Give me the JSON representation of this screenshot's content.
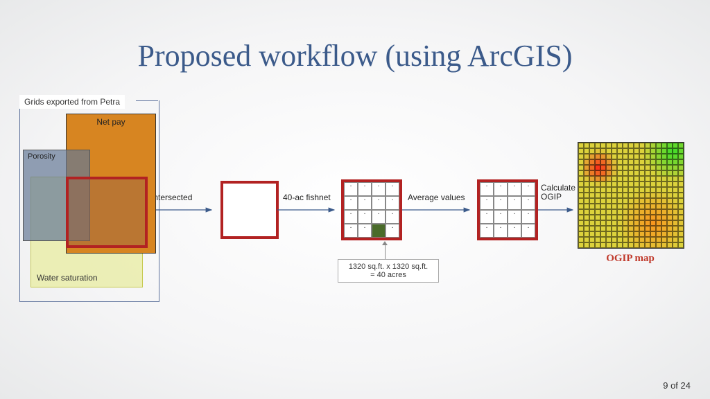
{
  "title": "Proposed workflow (using ArcGIS)",
  "footer": "9 of 24",
  "petra": {
    "group_label": "Grids exported from Petra",
    "netpay": "Net pay",
    "porosity": "Porosity",
    "watersat": "Water saturation"
  },
  "arrows": {
    "a1": "Intersected",
    "a2": "40-ac fishnet",
    "a3": "Average values",
    "a4": "Calculate OGIP"
  },
  "callout": {
    "line1": "1320 sq.ft. x 1320 sq.ft.",
    "line2": "= 40 acres"
  },
  "ogip_label": "OGIP map"
}
